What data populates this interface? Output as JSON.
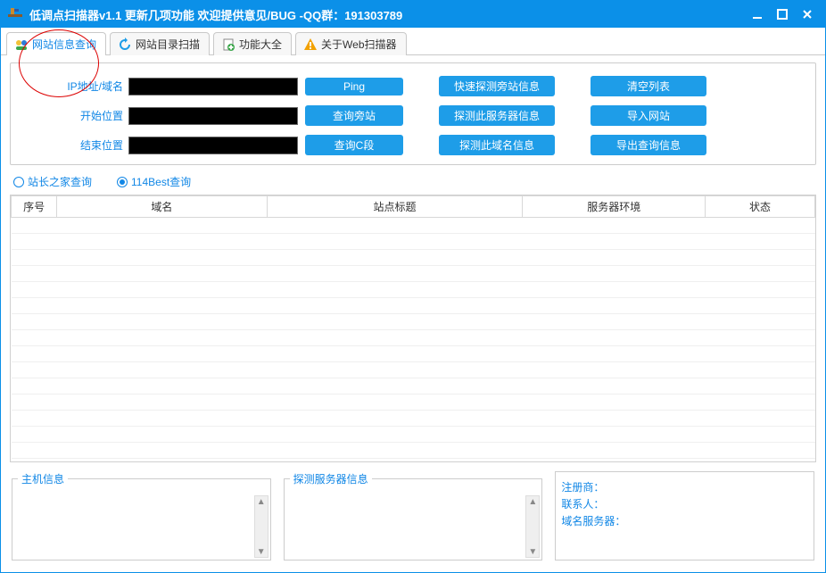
{
  "window": {
    "title": "低调点扫描器v1.1 更新几项功能 欢迎提供意见/BUG  -QQ群：191303789"
  },
  "tabs": [
    {
      "label": "网站信息查询",
      "active": true
    },
    {
      "label": "网站目录扫描",
      "active": false
    },
    {
      "label": "功能大全",
      "active": false
    },
    {
      "label": "关于Web扫描器",
      "active": false
    }
  ],
  "form": {
    "rows": [
      {
        "label": "IP地址/域名",
        "value": "",
        "btn1": "Ping",
        "btn2": "快速探测旁站信息",
        "btn3": "清空列表"
      },
      {
        "label": "开始位置",
        "value": "",
        "btn1": "查询旁站",
        "btn2": "探测此服务器信息",
        "btn3": "导入网站"
      },
      {
        "label": "结束位置",
        "value": "",
        "btn1": "查询C段",
        "btn2": "探测此域名信息",
        "btn3": "导出查询信息"
      }
    ]
  },
  "radios": {
    "opt1": "站长之家查询",
    "opt2": "114Best查询",
    "selected": "opt1"
  },
  "columns": [
    "序号",
    "域名",
    "站点标题",
    "服务器环境",
    "状态"
  ],
  "col_widths": [
    "50px",
    "230px",
    "280px",
    "200px",
    "120px"
  ],
  "rows": [],
  "blank_row_count": 15,
  "panels": {
    "host_info_title": "主机信息",
    "server_info_title": "探测服务器信息",
    "registrar_label": "注册商：",
    "contact_label": "联系人：",
    "dns_label": "域名服务器："
  }
}
